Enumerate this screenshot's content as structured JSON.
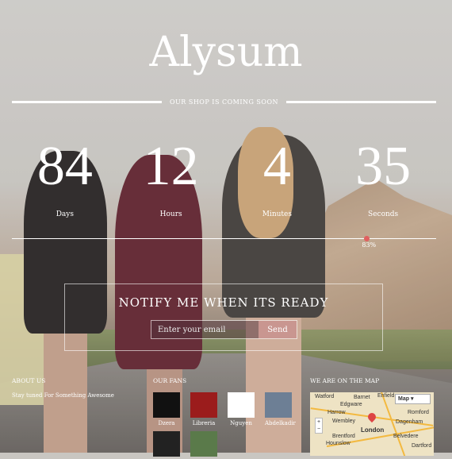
{
  "title": "Alysum",
  "subtitle": "OUR SHOP IS COMING SOON",
  "countdown": [
    {
      "value": "84",
      "label": "Days"
    },
    {
      "value": "12",
      "label": "Hours"
    },
    {
      "value": "4",
      "label": "Minutes"
    },
    {
      "value": "35",
      "label": "Seconds"
    }
  ],
  "progress": {
    "percent": 83,
    "label": "83%"
  },
  "notify": {
    "heading": "NOTIFY ME WHEN ITS READY",
    "placeholder": "Enter your email",
    "send": "Send"
  },
  "about": {
    "title": "ABOUT US",
    "text": "Stay tuned For Something Awesome"
  },
  "fans": {
    "title": "OUR FANS",
    "items": [
      {
        "name": "Dzera",
        "color": "#111"
      },
      {
        "name": "Libreria",
        "color": "#9b1c1c"
      },
      {
        "name": "Nguyen",
        "color": "#fff"
      },
      {
        "name": "Abdelkadir",
        "color": "#6d7f95"
      },
      {
        "name": "",
        "color": "#222"
      },
      {
        "name": "",
        "color": "#5a7a4a"
      }
    ]
  },
  "map": {
    "title": "WE ARE ON THE MAP",
    "type": "Map",
    "places": [
      "Barnet",
      "Enfield",
      "Edgware",
      "Harrow",
      "Wembley",
      "Romford",
      "Dagenham",
      "London",
      "Brentford",
      "Hounslow",
      "Belvedere",
      "Dartford",
      "Watford"
    ]
  }
}
